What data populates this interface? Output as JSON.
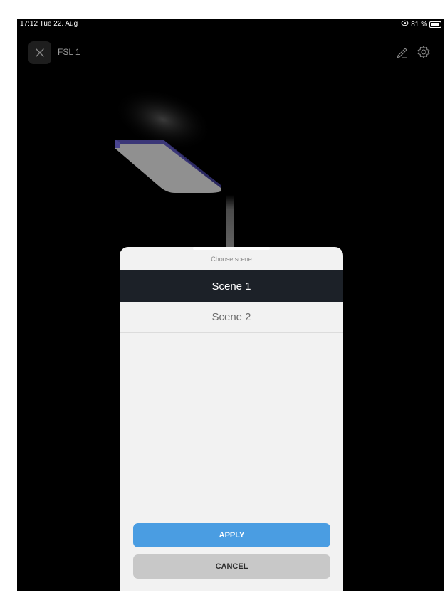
{
  "status_bar": {
    "time_date": "17:12  Tue 22. Aug",
    "battery_text": "81 %",
    "battery_level": 0.81
  },
  "header": {
    "device_title": "FSL 1",
    "close_icon": "close-icon",
    "edit_icon": "pencil-icon",
    "settings_icon": "gear-icon"
  },
  "scene_sheet": {
    "title": "Choose scene",
    "scenes": [
      {
        "label": "Scene 1",
        "selected": true
      },
      {
        "label": "Scene 2",
        "selected": false
      }
    ],
    "apply_label": "APPLY",
    "cancel_label": "CANCEL"
  },
  "colors": {
    "background": "#000000",
    "sheet": "#f2f2f2",
    "selected_row": "#1c2128",
    "apply": "#4a9de2",
    "cancel": "#c8c8c8",
    "lamp_accent": "#3b3778"
  }
}
